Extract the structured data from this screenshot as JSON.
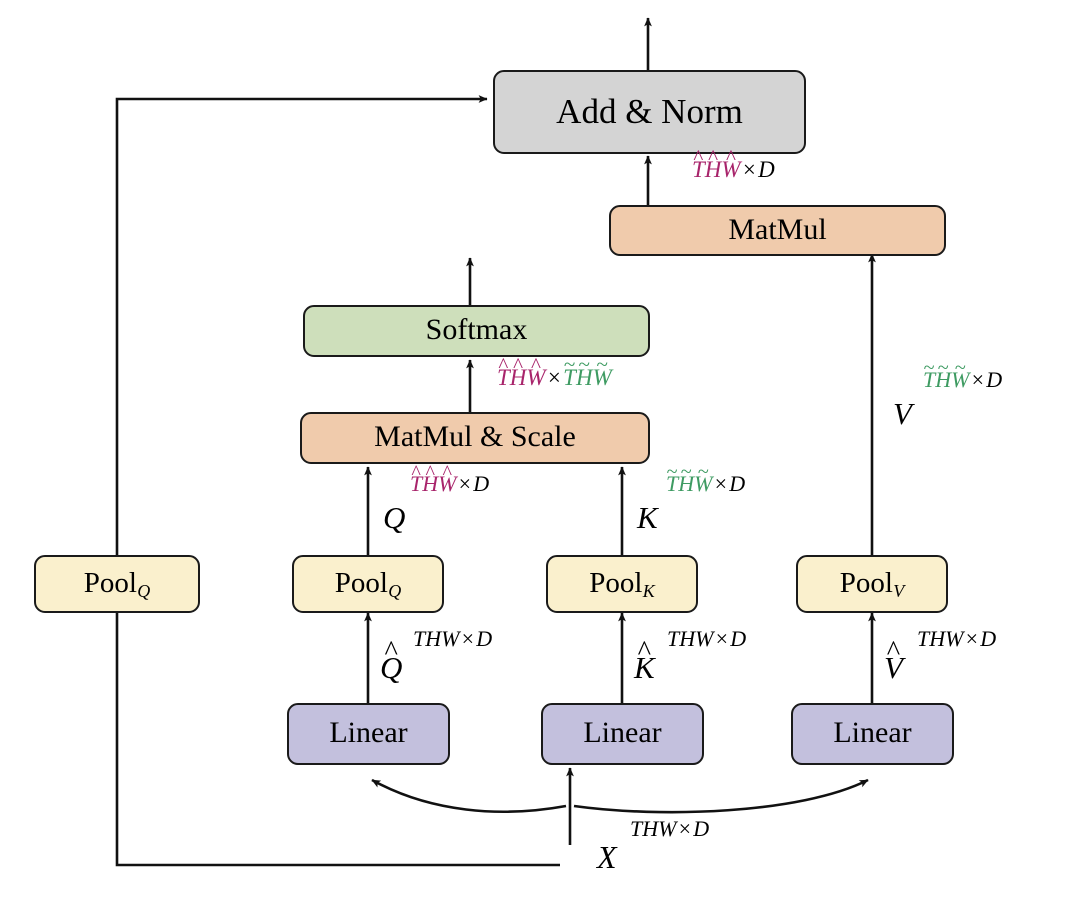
{
  "diagram": {
    "title": "Pooling Attention (MViT) block diagram",
    "colors": {
      "add_norm_fill": "#D4D4D4",
      "matmul_fill": "#F0CBAC",
      "softmax_fill": "#CEDFBB",
      "pool_fill": "#FAF0CD",
      "linear_fill": "#C3C0DD",
      "stroke": "#1a1a1a",
      "magenta": "#A8246B",
      "green": "#3E9B62",
      "background": "#FFFFFF"
    },
    "nodes": {
      "add_norm": {
        "label": "Add & Norm"
      },
      "matmul": {
        "label": "MatMul"
      },
      "softmax": {
        "label": "Softmax"
      },
      "matmul_scale": {
        "label": "MatMul & Scale"
      },
      "pool_q_skip": {
        "label": "Pool",
        "sub": "Q"
      },
      "pool_q": {
        "label": "Pool",
        "sub": "Q"
      },
      "pool_k": {
        "label": "Pool",
        "sub": "K"
      },
      "pool_v": {
        "label": "Pool",
        "sub": "V"
      },
      "linear_q": {
        "label": "Linear"
      },
      "linear_k": {
        "label": "Linear"
      },
      "linear_v": {
        "label": "Linear"
      }
    },
    "edge_labels": {
      "add_norm_in": {
        "tensor": "",
        "dims": "T̂ĤŴ × D",
        "parts": {
          "t": "T",
          "h": "H",
          "w": "W",
          "accent": "hat",
          "d": "D",
          "times": "×"
        }
      },
      "softmax_in": {
        "dims": "T̂ĤŴ × T̃H̃W̃",
        "left_accent": "hat",
        "right_accent": "tilde"
      },
      "q": {
        "tensor": "Q",
        "dims": "T̂ĤŴ × D",
        "accent": "hat"
      },
      "k": {
        "tensor": "K",
        "dims": "T̃H̃W̃ × D",
        "accent": "tilde"
      },
      "v": {
        "tensor": "V",
        "dims": "T̃H̃W̃ × D",
        "accent": "tilde"
      },
      "q_hat": {
        "tensor": "Q",
        "accent": "hat",
        "dims": "THW × D"
      },
      "k_hat": {
        "tensor": "K",
        "accent": "hat",
        "dims": "THW × D"
      },
      "v_hat": {
        "tensor": "V",
        "accent": "hat",
        "dims": "THW × D"
      },
      "x": {
        "tensor": "X",
        "dims": "THW × D"
      }
    },
    "symbols": {
      "T": "T",
      "H": "H",
      "W": "W",
      "D": "D",
      "times": "×",
      "hat": "^",
      "tilde": "~"
    }
  }
}
